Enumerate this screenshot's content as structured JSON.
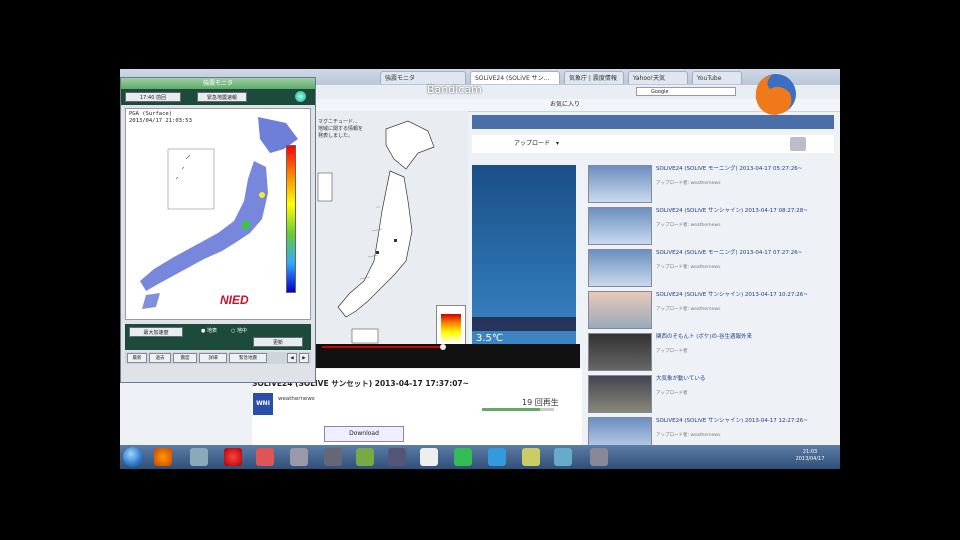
{
  "browser": {
    "tabs": [
      {
        "label": "SOLiVE24 (SOLiVE サン...",
        "active": true
      },
      {
        "label": "強震モニタ",
        "active": false
      },
      {
        "label": "気象庁 | 震度情報",
        "active": false
      },
      {
        "label": "Yahoo!天気",
        "active": false
      },
      {
        "label": "YouTube",
        "active": false
      }
    ],
    "bookmark_label": "お気に入り",
    "search_placeholder": "Google"
  },
  "watermark": "Bandicam",
  "map_notice": "マグニチュード...\n地域に関する情報を\n発表しました。",
  "youtube": {
    "nav_label": "アップロード",
    "video_title": "SOLiVE24 (SOLiVE サンセット) 2013-04-17 17:37:07~",
    "channel_logo_text": "WNI",
    "channel_name": "weathernews",
    "view_count": "19 回再生",
    "download_label": "Download",
    "temperature": "3.5℃",
    "related": [
      {
        "title": "SOLiVE24 (SOLiVE モーニング) 2013-04-17 05:27:26~",
        "meta": "アップロード者: weathernews"
      },
      {
        "title": "SOLiVE24 (SOLiVE サンシャイン) 2013-04-17 08:27:28~",
        "meta": "アップロード者: weathernews"
      },
      {
        "title": "SOLiVE24 (SOLiVE モーニング) 2013-04-17 07:27:26~",
        "meta": "アップロード者: weathernews"
      },
      {
        "title": "SOLiVE24 (SOLiVE サンシャイン) 2013-04-17 10:27:26~",
        "meta": "アップロード者: weathernews"
      },
      {
        "title": "関西のそもんト (ボケ)の-谷生週報外来",
        "meta": "アップロード者"
      },
      {
        "title": "大気象が動いている",
        "meta": "アップロード者"
      },
      {
        "title": "SOLiVE24 (SOLiVE サンシャイン) 2013-04-17 12:27:26~",
        "meta": "アップロード者: weathernews"
      }
    ]
  },
  "kyoshin": {
    "title": "強震モニタ",
    "toolbar_btn1": "17:40 前回",
    "toolbar_btn2": "緊急地震速報",
    "pga_line1": "PGA (Surface)",
    "pga_line2": "2013/04/17 21:03:53",
    "logo": "NIED",
    "control_select": "最大加速度",
    "radio1": "地表",
    "radio2": "地中",
    "reset_label": "更新",
    "tabs": [
      "最新",
      "過去",
      "震度",
      "詳細",
      "緊急地震"
    ]
  },
  "taskbar": {
    "clock_time": "21:03",
    "clock_date": "2013/04/17"
  },
  "colors": {
    "scale_top": "#ff0000",
    "scale_mid": "#ffff00",
    "scale_bottom": "#0000cc",
    "youtube_blue": "#4a6fa8"
  }
}
